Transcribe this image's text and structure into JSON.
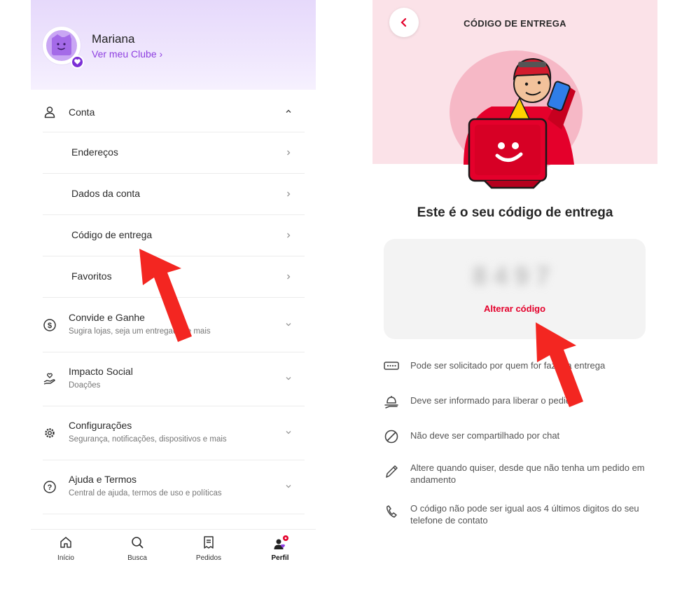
{
  "left": {
    "profile": {
      "name": "Mariana",
      "club_link": "Ver meu Clube ›"
    },
    "sections": {
      "account": {
        "title": "Conta"
      },
      "submenu": [
        {
          "label": "Endereços"
        },
        {
          "label": "Dados da conta"
        },
        {
          "label": "Código de entrega"
        },
        {
          "label": "Favoritos"
        }
      ],
      "invite": {
        "title": "Convide e Ganhe",
        "subtitle": "Sugira lojas, seja um entregador e mais"
      },
      "impact": {
        "title": "Impacto Social",
        "subtitle": "Doações"
      },
      "settings": {
        "title": "Configurações",
        "subtitle": "Segurança, notificações, dispositivos e mais"
      },
      "help": {
        "title": "Ajuda e Termos",
        "subtitle": "Central de ajuda, termos de uso e políticas"
      }
    },
    "bottom_nav": [
      {
        "label": "Início",
        "icon": "home-icon"
      },
      {
        "label": "Busca",
        "icon": "search-icon"
      },
      {
        "label": "Pedidos",
        "icon": "receipt-icon"
      },
      {
        "label": "Perfil",
        "icon": "profile-icon"
      }
    ]
  },
  "right": {
    "title": "CÓDIGO DE ENTREGA",
    "heading": "Este é o seu código de entrega",
    "code": "8497",
    "change_code": "Alterar código",
    "info": [
      {
        "icon": "keypad-icon",
        "text": "Pode ser solicitado por quem for fazer a entrega"
      },
      {
        "icon": "bell-hand-icon",
        "text": "Deve ser informado para liberar o pedido"
      },
      {
        "icon": "forbidden-icon",
        "text": "Não deve ser compartilhado por chat"
      },
      {
        "icon": "pencil-icon",
        "text": "Altere quando quiser, desde que não tenha um pedido em andamento"
      },
      {
        "icon": "phone-icon",
        "text": "O código não pode ser igual aos 4 últimos digitos do seu telefone de contato"
      }
    ]
  },
  "colors": {
    "brand_red": "#e4002b",
    "club_purple": "#8d3fe0",
    "hero_pink": "#fbe2e8",
    "arrow_red": "#f32621"
  }
}
